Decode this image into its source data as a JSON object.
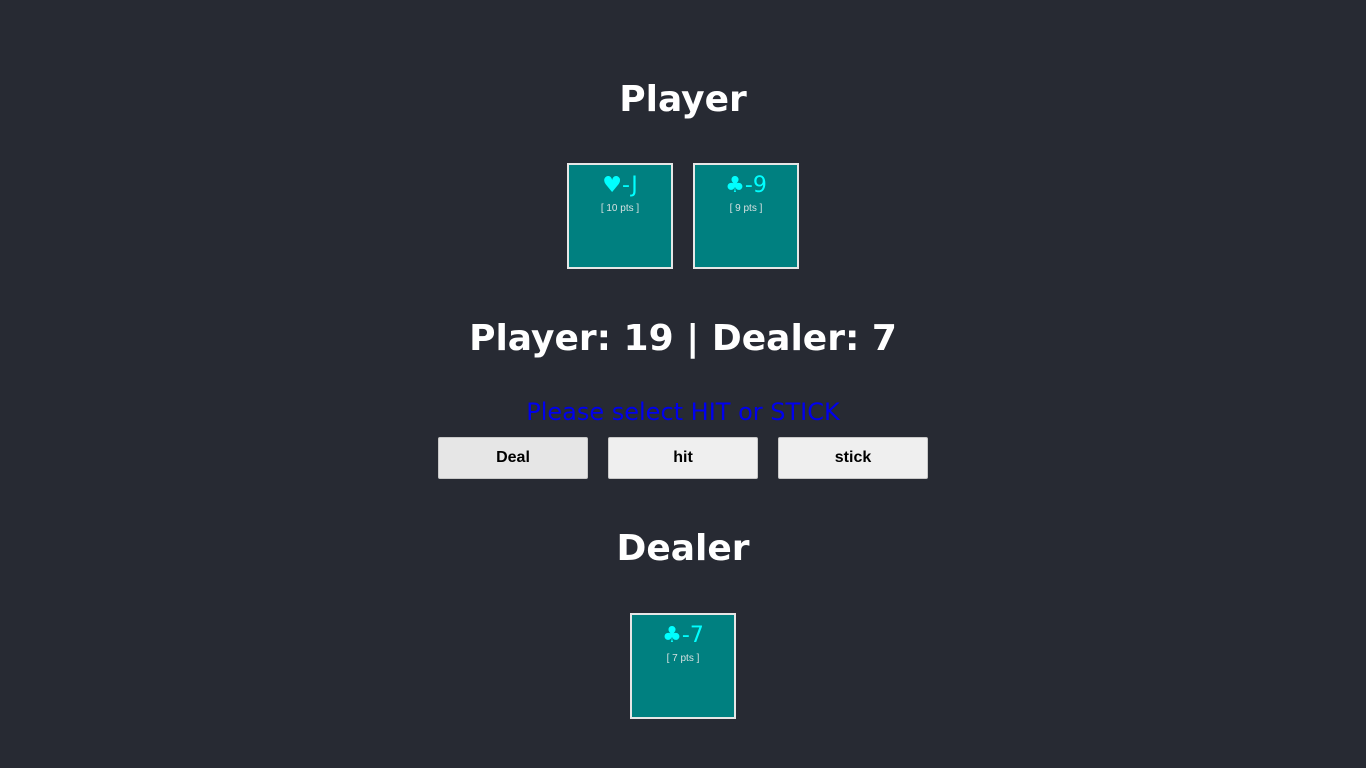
{
  "player": {
    "heading": "Player",
    "cards": [
      {
        "suit_icon": "heart-icon",
        "suit_glyph": "♥",
        "rank": "-J",
        "points": "[ 10 pts ]"
      },
      {
        "suit_icon": "club-icon",
        "suit_glyph": "♣",
        "rank": "-9",
        "points": "[ 9 pts ]"
      }
    ]
  },
  "score": {
    "text": "Player: 19 | Dealer: 7"
  },
  "status": {
    "message": "Please select HIT or STICK"
  },
  "controls": {
    "deal_label": "Deal",
    "hit_label": "hit",
    "stick_label": "stick"
  },
  "dealer": {
    "heading": "Dealer",
    "cards": [
      {
        "suit_icon": "club-icon",
        "suit_glyph": "♣",
        "rank": "-7",
        "points": "[ 7 pts ]"
      }
    ]
  },
  "colors": {
    "background": "#272a33",
    "card_fill": "#008080",
    "card_text": "#00ffff",
    "status_text": "#0000ee"
  }
}
